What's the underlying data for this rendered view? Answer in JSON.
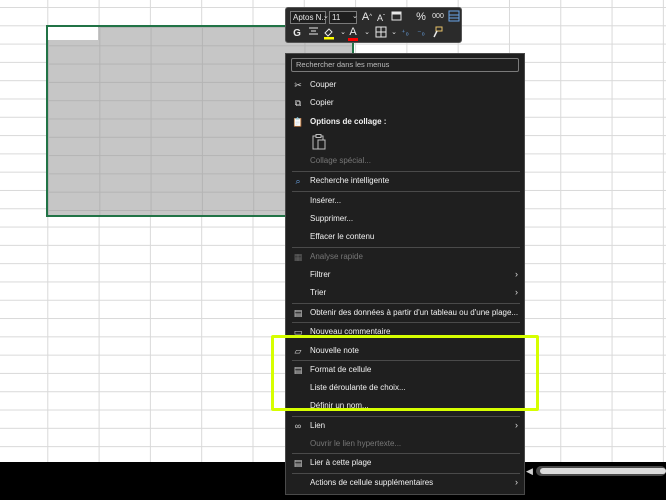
{
  "mini_toolbar": {
    "font_name": "Aptos N...",
    "font_size": "11",
    "grow_font": "A",
    "shrink_font": "A",
    "percent": "%",
    "thousands": "000",
    "bold": "G",
    "font_color_letter": "A",
    "highlight_color": "#ffff00",
    "font_color": "#ff0000"
  },
  "menu": {
    "search_placeholder": "Rechercher dans les menus",
    "cut": "Couper",
    "copy": "Copier",
    "paste_options": "Options de collage :",
    "paste_special": "Collage spécial...",
    "smart_lookup": "Recherche intelligente",
    "insert": "Insérer...",
    "delete": "Supprimer...",
    "clear": "Effacer le contenu",
    "quick_analysis": "Analyse rapide",
    "filter": "Filtrer",
    "sort": "Trier",
    "get_data": "Obtenir des données à partir d'un tableau ou d'une plage...",
    "new_comment": "Nouveau commentaire",
    "new_note": "Nouvelle note",
    "format_cells": "Format de cellule",
    "dropdown_list": "Liste déroulante de choix...",
    "define_name": "Définir un nom...",
    "link": "Lien",
    "open_link": "Ouvrir le lien hypertexte...",
    "link_to_range": "Lier à cette plage",
    "more_actions": "Actions de cellule supplémentaires"
  },
  "colors": {
    "selection_border": "#217346",
    "highlight_box": "#d6ff00"
  }
}
